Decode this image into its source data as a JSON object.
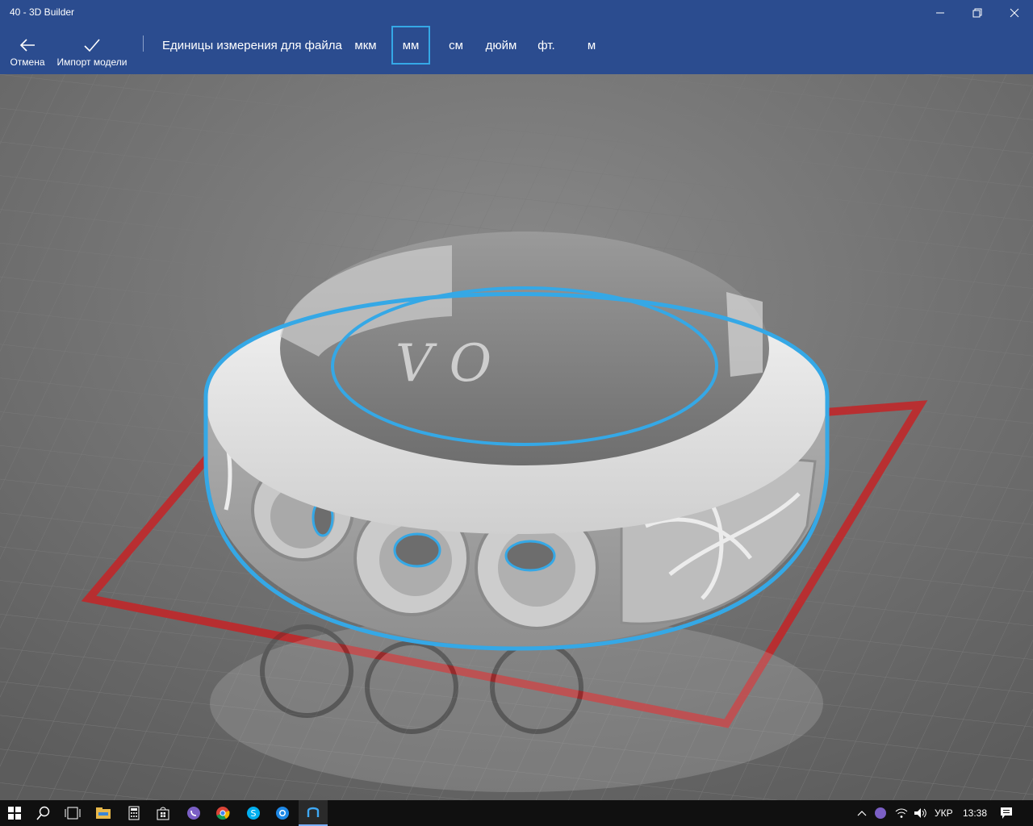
{
  "window": {
    "title": "40 - 3D Builder"
  },
  "toolbar": {
    "cancel_label": "Отмена",
    "import_label": "Импорт модели",
    "units_label": "Единицы измерения для файла",
    "units": [
      {
        "label": "мкм",
        "selected": false
      },
      {
        "label": "мм",
        "selected": true
      },
      {
        "label": "см",
        "selected": false
      },
      {
        "label": "дюйм",
        "selected": false
      },
      {
        "label": "фт.",
        "selected": false
      },
      {
        "label": "м",
        "selected": false
      }
    ]
  },
  "model": {
    "engraving": "V O",
    "selection_color": "#35a8e6",
    "plate_color": "#c0282a"
  },
  "taskbar": {
    "icons": [
      "windows-start-icon",
      "search-icon",
      "task-view-icon",
      "file-explorer-icon",
      "calculator-icon",
      "store-icon",
      "viber-icon",
      "chrome-icon",
      "skype-icon",
      "browser-icon",
      "3d-builder-icon"
    ],
    "tray_lang": "УКР",
    "tray_time": "13:38"
  },
  "colors": {
    "accent": "#2b4c8f",
    "taskbar": "#101010"
  }
}
